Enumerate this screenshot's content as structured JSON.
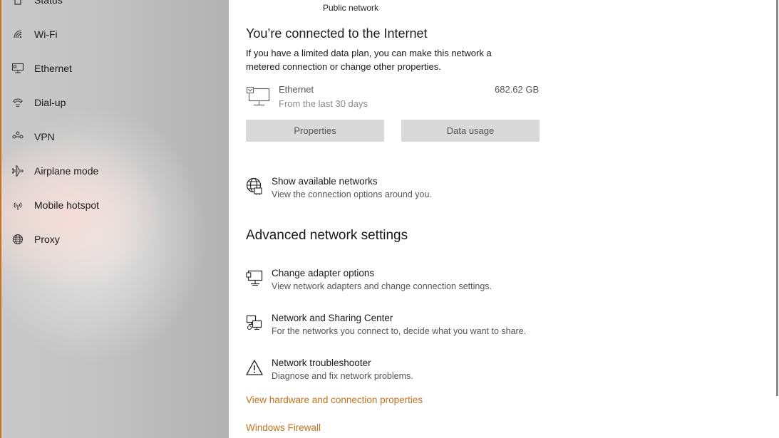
{
  "sidebar": {
    "items": [
      {
        "label": "Status",
        "icon": "home-status-icon"
      },
      {
        "label": "Wi-Fi",
        "icon": "wifi-icon"
      },
      {
        "label": "Ethernet",
        "icon": "ethernet-icon"
      },
      {
        "label": "Dial-up",
        "icon": "dialup-icon"
      },
      {
        "label": "VPN",
        "icon": "vpn-icon"
      },
      {
        "label": "Airplane mode",
        "icon": "airplane-icon"
      },
      {
        "label": "Mobile hotspot",
        "icon": "hotspot-icon"
      },
      {
        "label": "Proxy",
        "icon": "globe-icon"
      }
    ]
  },
  "main": {
    "network_type": "Public network",
    "connected_heading": "You’re connected to the Internet",
    "connected_desc": "If you have a limited data plan, you can make this network a metered connection or change other properties.",
    "usage": {
      "name": "Ethernet",
      "period": "From the last 30 days",
      "amount": "682.62 GB"
    },
    "buttons": {
      "properties": "Properties",
      "data_usage": "Data usage"
    },
    "show_networks": {
      "title": "Show available networks",
      "desc": "View the connection options around you."
    },
    "advanced_heading": "Advanced network settings",
    "advanced_items": [
      {
        "title": "Change adapter options",
        "desc": "View network adapters and change connection settings.",
        "icon": "adapter-icon"
      },
      {
        "title": "Network and Sharing Center",
        "desc": "For the networks you connect to, decide what you want to share.",
        "icon": "sharing-center-icon"
      },
      {
        "title": "Network troubleshooter",
        "desc": "Diagnose and fix network problems.",
        "icon": "warning-icon"
      }
    ],
    "links": {
      "hardware": "View hardware and connection properties",
      "firewall": "Windows Firewall"
    }
  },
  "colors": {
    "accent": "#c0731c",
    "sidebar_bg": "#c3c3c3",
    "button_bg": "#d9d9d9"
  }
}
